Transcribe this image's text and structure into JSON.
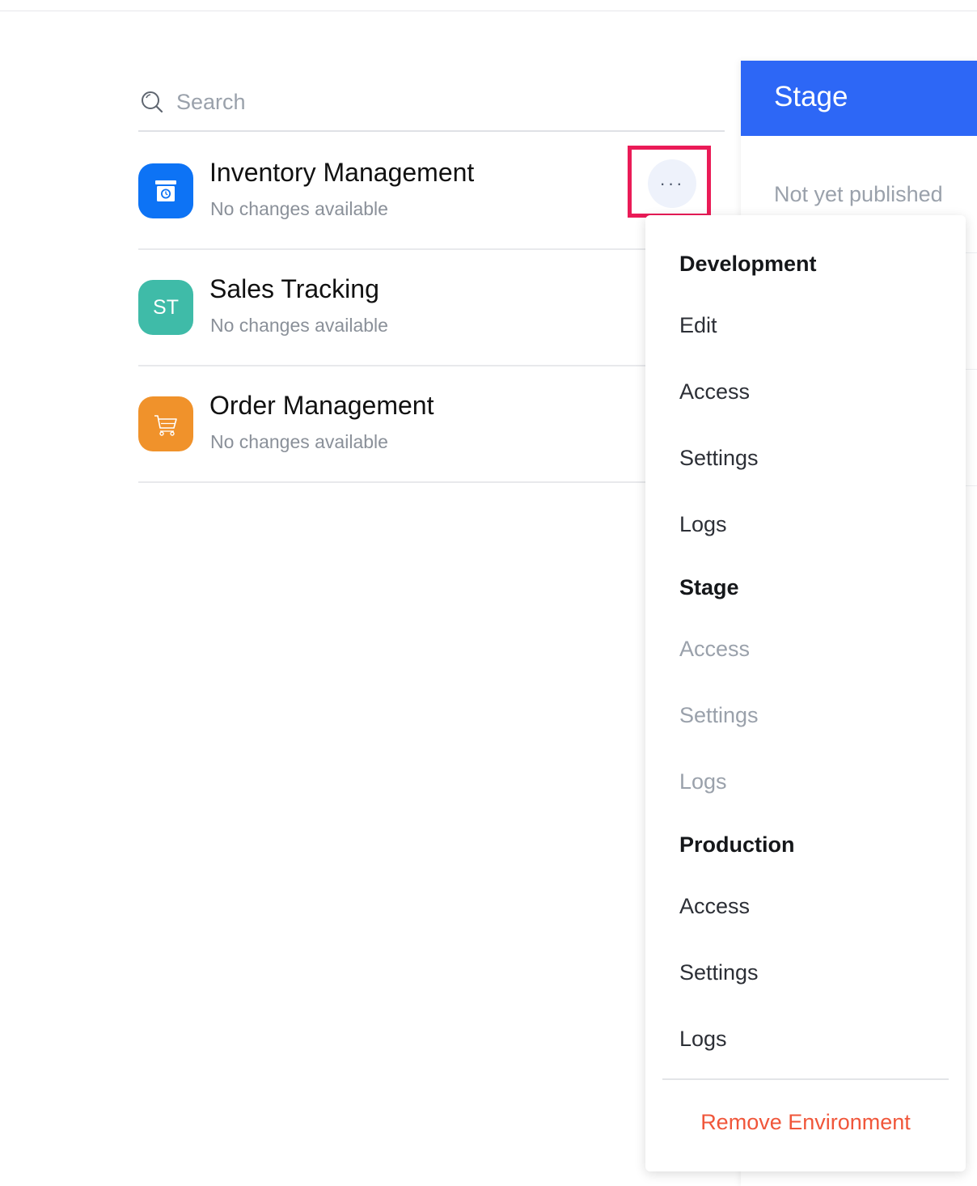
{
  "search": {
    "placeholder": "Search"
  },
  "apps": [
    {
      "title": "Inventory Management",
      "subtitle": "No changes available",
      "icon": "inventory-box-icon",
      "icon_color": "#0d73f5"
    },
    {
      "title": "Sales Tracking",
      "subtitle": "No changes available",
      "icon_text": "ST",
      "icon_color": "#3fbba8"
    },
    {
      "title": "Order Management",
      "subtitle": "No changes available",
      "icon": "shopping-cart-icon",
      "icon_color": "#f0922b"
    }
  ],
  "more_button": {
    "label": "···",
    "highlight_color": "#ea1b57"
  },
  "stage_panel": {
    "title": "Stage",
    "status": "Not yet published",
    "header_color": "#2d67f6"
  },
  "menu": {
    "development": {
      "heading": "Development",
      "items": [
        "Edit",
        "Access",
        "Settings",
        "Logs"
      ]
    },
    "stage": {
      "heading": "Stage",
      "items": [
        "Access",
        "Settings",
        "Logs"
      ]
    },
    "production": {
      "heading": "Production",
      "items": [
        "Access",
        "Settings",
        "Logs"
      ]
    },
    "remove": "Remove Environment",
    "danger_color": "#f0563a"
  }
}
